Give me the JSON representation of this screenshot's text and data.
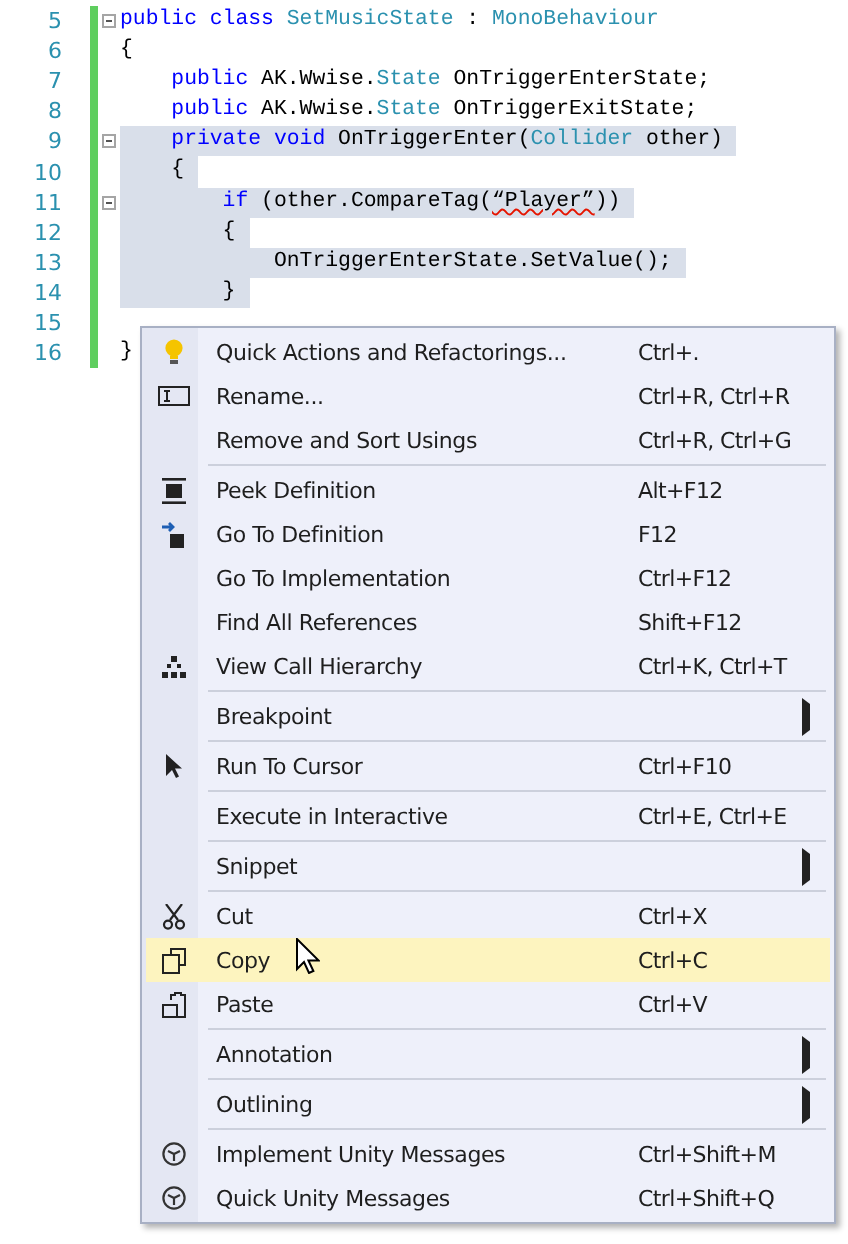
{
  "code": {
    "lines": [
      {
        "number": "5",
        "collapsible": true,
        "highlighted": false,
        "tokens": [
          {
            "kind": "keyword",
            "text": "public class"
          },
          {
            "kind": "type",
            "text": " SetMusicState"
          },
          {
            "kind": "plain",
            "text": " : "
          },
          {
            "kind": "type",
            "text": "MonoBehaviour"
          }
        ]
      },
      {
        "number": "6",
        "collapsible": false,
        "highlighted": false,
        "tokens": [
          {
            "kind": "plain",
            "text": "{"
          }
        ]
      },
      {
        "number": "7",
        "collapsible": false,
        "highlighted": false,
        "tokens": [
          {
            "kind": "keyword",
            "text": "    public"
          },
          {
            "kind": "plain",
            "text": " AK.Wwise."
          },
          {
            "kind": "type",
            "text": "State"
          },
          {
            "kind": "plain",
            "text": " OnTriggerEnterState;"
          }
        ]
      },
      {
        "number": "8",
        "collapsible": false,
        "highlighted": false,
        "tokens": [
          {
            "kind": "keyword",
            "text": "    public"
          },
          {
            "kind": "plain",
            "text": " AK.Wwise."
          },
          {
            "kind": "type",
            "text": "State"
          },
          {
            "kind": "plain",
            "text": " OnTriggerExitState;"
          }
        ]
      },
      {
        "number": "9",
        "collapsible": true,
        "highlighted": true,
        "tokens": [
          {
            "kind": "keyword",
            "text": "    private void"
          },
          {
            "kind": "plain",
            "text": " OnTriggerEnter("
          },
          {
            "kind": "type",
            "text": "Collider"
          },
          {
            "kind": "plain",
            "text": " other)"
          }
        ]
      },
      {
        "number": "10",
        "collapsible": false,
        "highlighted": true,
        "tokens": [
          {
            "kind": "plain",
            "text": "    {"
          }
        ]
      },
      {
        "number": "11",
        "collapsible": true,
        "highlighted": true,
        "tokens": [
          {
            "kind": "keyword",
            "text": "        if"
          },
          {
            "kind": "plain",
            "text": " (other.CompareTag("
          },
          {
            "kind": "squiggle",
            "text": "“Player”"
          },
          {
            "kind": "plain",
            "text": "))"
          }
        ]
      },
      {
        "number": "12",
        "collapsible": false,
        "highlighted": true,
        "tokens": [
          {
            "kind": "plain",
            "text": "        {"
          }
        ]
      },
      {
        "number": "13",
        "collapsible": false,
        "highlighted": true,
        "tokens": [
          {
            "kind": "plain",
            "text": "            OnTriggerEnterState.SetValue();"
          }
        ]
      },
      {
        "number": "14",
        "collapsible": false,
        "highlighted": true,
        "tokens": [
          {
            "kind": "plain",
            "text": "        }"
          }
        ]
      },
      {
        "number": "15",
        "collapsible": false
      },
      {
        "number": "16",
        "collapsible": false,
        "highlighted": false,
        "tokens": [
          {
            "kind": "plain",
            "text": "}"
          }
        ]
      }
    ]
  },
  "context_menu": {
    "items": [
      {
        "kind": "item",
        "label": "Quick Actions and Refactorings...",
        "shortcut": "Ctrl+.",
        "submenu": false,
        "selected": false
      },
      {
        "kind": "item",
        "label": "Rename...",
        "shortcut": "Ctrl+R, Ctrl+R",
        "submenu": false,
        "selected": false
      },
      {
        "kind": "item",
        "label": "Remove and Sort Usings",
        "shortcut": "Ctrl+R, Ctrl+G",
        "submenu": false,
        "selected": false
      },
      {
        "kind": "separator"
      },
      {
        "kind": "item",
        "label": "Peek Definition",
        "shortcut": "Alt+F12",
        "submenu": false,
        "selected": false
      },
      {
        "kind": "item",
        "label": "Go To Definition",
        "shortcut": "F12",
        "submenu": false,
        "selected": false
      },
      {
        "kind": "item",
        "label": "Go To Implementation",
        "shortcut": "Ctrl+F12",
        "submenu": false,
        "selected": false
      },
      {
        "kind": "item",
        "label": "Find All References",
        "shortcut": "Shift+F12",
        "submenu": false,
        "selected": false
      },
      {
        "kind": "item",
        "label": "View Call Hierarchy",
        "shortcut": "Ctrl+K, Ctrl+T",
        "submenu": false,
        "selected": false
      },
      {
        "kind": "separator"
      },
      {
        "kind": "item",
        "label": "Breakpoint",
        "submenu": true,
        "selected": false
      },
      {
        "kind": "separator"
      },
      {
        "kind": "item",
        "label": "Run To Cursor",
        "shortcut": "Ctrl+F10",
        "submenu": false,
        "selected": false
      },
      {
        "kind": "separator"
      },
      {
        "kind": "item",
        "label": "Execute in Interactive",
        "shortcut": "Ctrl+E, Ctrl+E",
        "submenu": false,
        "selected": false
      },
      {
        "kind": "separator"
      },
      {
        "kind": "item",
        "label": "Snippet",
        "submenu": true,
        "selected": false
      },
      {
        "kind": "separator"
      },
      {
        "kind": "item",
        "label": "Cut",
        "shortcut": "Ctrl+X",
        "submenu": false,
        "selected": false
      },
      {
        "kind": "item",
        "label": "Copy",
        "shortcut": "Ctrl+C",
        "submenu": false,
        "selected": true
      },
      {
        "kind": "item",
        "label": "Paste",
        "shortcut": "Ctrl+V",
        "submenu": false,
        "selected": false
      },
      {
        "kind": "separator"
      },
      {
        "kind": "item",
        "label": "Annotation",
        "submenu": true,
        "selected": false
      },
      {
        "kind": "separator"
      },
      {
        "kind": "item",
        "label": "Outlining",
        "submenu": true,
        "selected": false
      },
      {
        "kind": "separator"
      },
      {
        "kind": "item",
        "label": "Implement Unity Messages",
        "shortcut": "Ctrl+Shift+M",
        "submenu": false,
        "selected": false
      },
      {
        "kind": "item",
        "label": "Quick Unity Messages",
        "shortcut": "Ctrl+Shift+Q",
        "submenu": false,
        "selected": false
      }
    ]
  }
}
